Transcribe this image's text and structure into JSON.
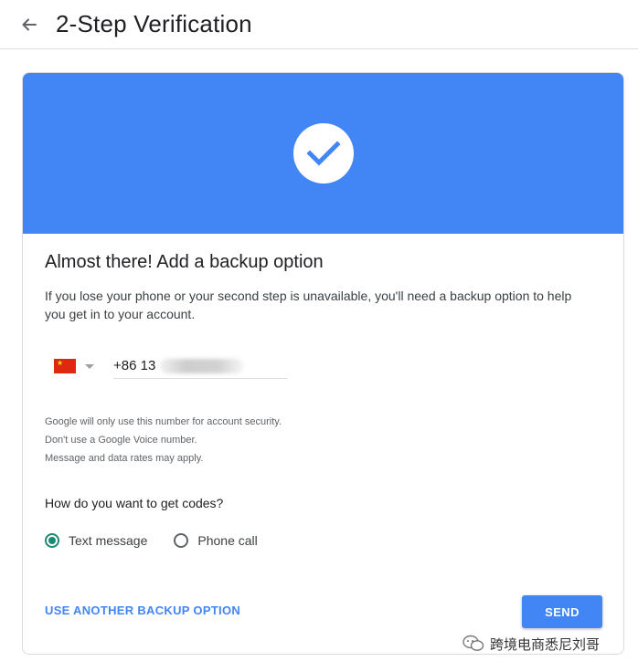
{
  "header": {
    "title": "2-Step Verification",
    "back_icon": "arrow-left-icon"
  },
  "banner": {
    "color": "#4285f4",
    "icon": "check-circle-icon"
  },
  "content": {
    "heading": "Almost there! Add a backup option",
    "description": "If you lose your phone or your second step is unavailable, you'll need a backup option to help you get in to your account."
  },
  "phone": {
    "country_flag": "china-flag-icon",
    "value": "+86 13"
  },
  "notes": [
    "Google will only use this number for account security.",
    "Don't use a Google Voice number.",
    "Message and data rates may apply."
  ],
  "codes": {
    "question": "How do you want to get codes?",
    "options": [
      {
        "label": "Text message",
        "selected": true
      },
      {
        "label": "Phone call",
        "selected": false
      }
    ]
  },
  "actions": {
    "alternate_label": "USE ANOTHER BACKUP OPTION",
    "send_label": "SEND"
  },
  "watermark": {
    "text": "跨境电商悉尼刘哥"
  },
  "colors": {
    "accent": "#4285f4",
    "radio_selected": "#1a8a73"
  }
}
